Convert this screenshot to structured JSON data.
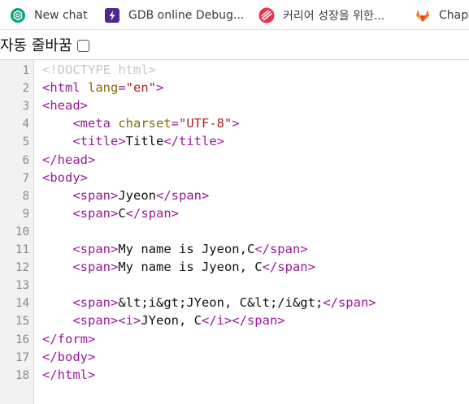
{
  "bookmarks": [
    {
      "label": "New chat",
      "icon": "chatgpt-icon"
    },
    {
      "label": "GDB online Debug...",
      "icon": "gdb-icon"
    },
    {
      "label": "커리어 성장을 위한...",
      "icon": "career-icon"
    },
    {
      "label": "Chapt",
      "icon": "gitlab-icon"
    }
  ],
  "wrap": {
    "label": "자동 줄바꿈"
  },
  "colors": {
    "tag": "#9a1a9a",
    "attr": "#8a6a00",
    "string": "#b02020",
    "text": "#111111",
    "doctype": "#c8c8c8",
    "gutter": "#f2f2f2"
  },
  "code": {
    "lines": [
      {
        "n": "1",
        "indent": "",
        "parts": [
          {
            "t": "<!DOCTYPE html>",
            "k": "doc"
          }
        ]
      },
      {
        "n": "2",
        "indent": "",
        "parts": [
          {
            "t": "<html ",
            "k": "tag"
          },
          {
            "t": "lang",
            "k": "attr"
          },
          {
            "t": "=",
            "k": "tag"
          },
          {
            "t": "\"en\"",
            "k": "str"
          },
          {
            "t": ">",
            "k": "tag"
          }
        ]
      },
      {
        "n": "3",
        "indent": "",
        "parts": [
          {
            "t": "<head>",
            "k": "tag"
          }
        ]
      },
      {
        "n": "4",
        "indent": "    ",
        "parts": [
          {
            "t": "<meta ",
            "k": "tag"
          },
          {
            "t": "charset",
            "k": "attr"
          },
          {
            "t": "=",
            "k": "tag"
          },
          {
            "t": "\"UTF-8\"",
            "k": "str"
          },
          {
            "t": ">",
            "k": "tag"
          }
        ]
      },
      {
        "n": "5",
        "indent": "    ",
        "parts": [
          {
            "t": "<title>",
            "k": "tag"
          },
          {
            "t": "Title",
            "k": "txt"
          },
          {
            "t": "</title>",
            "k": "tag"
          }
        ]
      },
      {
        "n": "6",
        "indent": "",
        "parts": [
          {
            "t": "</head>",
            "k": "tag"
          }
        ]
      },
      {
        "n": "7",
        "indent": "",
        "parts": [
          {
            "t": "<body>",
            "k": "tag"
          }
        ]
      },
      {
        "n": "8",
        "indent": "    ",
        "parts": [
          {
            "t": "<span>",
            "k": "tag"
          },
          {
            "t": "Jyeon",
            "k": "txt"
          },
          {
            "t": "</span>",
            "k": "tag"
          }
        ]
      },
      {
        "n": "9",
        "indent": "    ",
        "parts": [
          {
            "t": "<span>",
            "k": "tag"
          },
          {
            "t": "C",
            "k": "txt"
          },
          {
            "t": "</span>",
            "k": "tag"
          }
        ]
      },
      {
        "n": "10",
        "indent": "",
        "parts": []
      },
      {
        "n": "11",
        "indent": "    ",
        "parts": [
          {
            "t": "<span>",
            "k": "tag"
          },
          {
            "t": "My name is Jyeon,C",
            "k": "txt"
          },
          {
            "t": "</span>",
            "k": "tag"
          }
        ]
      },
      {
        "n": "12",
        "indent": "    ",
        "parts": [
          {
            "t": "<span>",
            "k": "tag"
          },
          {
            "t": "My name is Jyeon, C",
            "k": "txt"
          },
          {
            "t": "</span>",
            "k": "tag"
          }
        ]
      },
      {
        "n": "13",
        "indent": "",
        "parts": []
      },
      {
        "n": "14",
        "indent": "    ",
        "parts": [
          {
            "t": "<span>",
            "k": "tag"
          },
          {
            "t": "&lt;i&gt;JYeon, C&lt;/i&gt;",
            "k": "txt"
          },
          {
            "t": "</span>",
            "k": "tag"
          }
        ]
      },
      {
        "n": "15",
        "indent": "    ",
        "parts": [
          {
            "t": "<span><i>",
            "k": "tag"
          },
          {
            "t": "JYeon, C",
            "k": "txt"
          },
          {
            "t": "</i></span>",
            "k": "tag"
          }
        ]
      },
      {
        "n": "16",
        "indent": "",
        "parts": [
          {
            "t": "</form>",
            "k": "tag"
          }
        ]
      },
      {
        "n": "17",
        "indent": "",
        "parts": [
          {
            "t": "</body>",
            "k": "tag"
          }
        ]
      },
      {
        "n": "18",
        "indent": "",
        "parts": [
          {
            "t": "</html>",
            "k": "tag"
          }
        ]
      }
    ]
  }
}
